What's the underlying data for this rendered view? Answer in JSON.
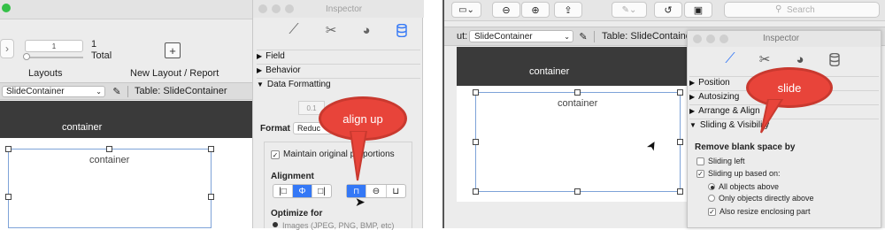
{
  "left_window": {
    "layout_number": "1",
    "total_count": "1",
    "total_label": "Total",
    "layouts_label": "Layouts",
    "new_layout_label": "New Layout / Report",
    "object_select": "SlideContainer",
    "table_label": "Table: SlideContainer",
    "header_part_label": "container",
    "object_label": "container"
  },
  "inspector_left": {
    "title": "Inspector",
    "sections": [
      "Field",
      "Behavior",
      "Data Formatting"
    ],
    "format_label": "Format",
    "format_value": "Reduc",
    "maintain_label": "Maintain original proportions",
    "alignment_label": "Alignment",
    "optimize_label": "Optimize for",
    "images_label": "Images (JPEG, PNG, BMP, etc)",
    "stepper_value": "0.1"
  },
  "callouts": {
    "align_up": "align up",
    "slide": "slide"
  },
  "right_window": {
    "search_placeholder": "Search",
    "layout_prefix": "ut:",
    "object_select": "SlideContainer",
    "table_label": "Table: SlideContainer",
    "header_part_label": "container",
    "object_label": "container"
  },
  "inspector_right": {
    "title": "Inspector",
    "sections": [
      "Position",
      "Autosizing",
      "Arrange & Align",
      "Sliding & Visibility"
    ],
    "remove_blank_label": "Remove blank space by",
    "sliding_left": "Sliding left",
    "sliding_up": "Sliding up based on:",
    "all_objects": "All objects above",
    "only_objects": "Only objects directly above",
    "also_resize": "Also resize enclosing part"
  },
  "colors": {
    "accent": "#3478f6",
    "callout": "#e8443a",
    "dark_bar": "#3a3a3a"
  }
}
